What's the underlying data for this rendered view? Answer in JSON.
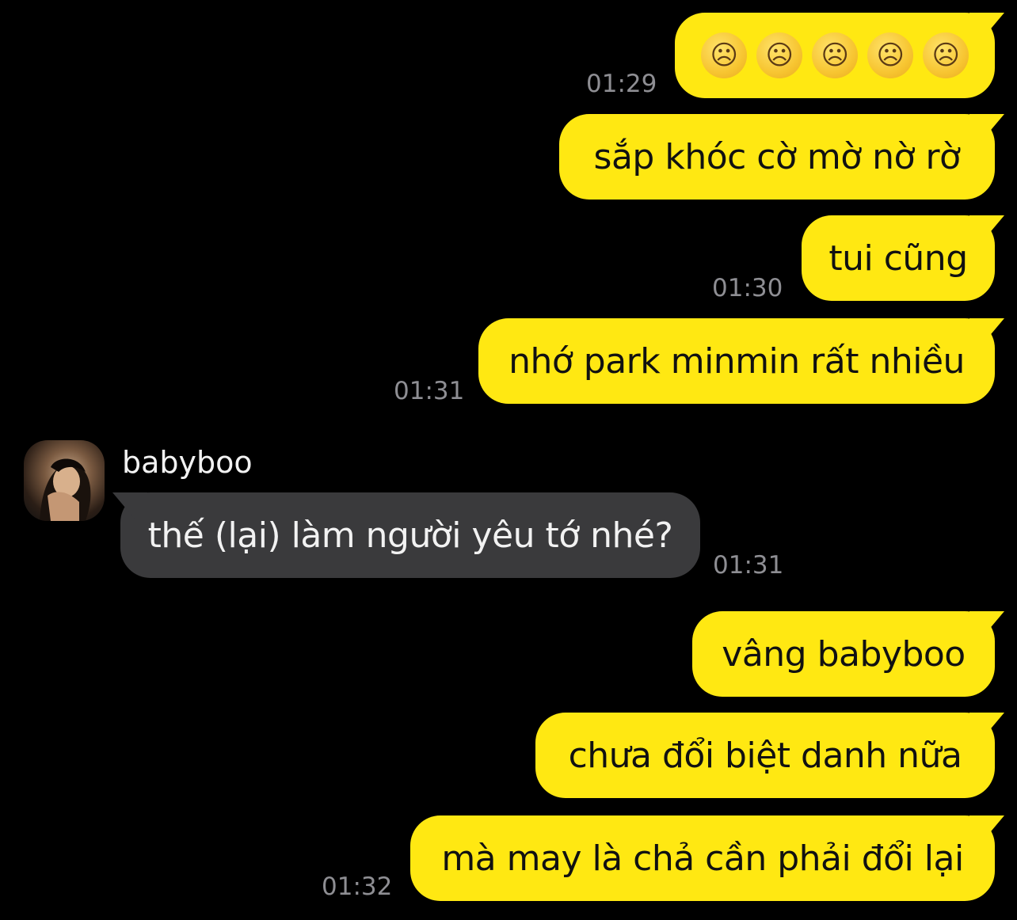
{
  "colors": {
    "background": "#000000",
    "outgoing_bubble": "#FFE812",
    "incoming_bubble": "#3A3A3C",
    "timestamp": "#8E8E93"
  },
  "messages": [
    {
      "from": "me",
      "type": "emoji",
      "emojis": [
        "☹",
        "☹",
        "☹",
        "☹",
        "☹"
      ],
      "emoji_names": [
        "worried-face",
        "confused-face",
        "slightly-frowning-face",
        "frowning-face",
        "loudly-crying-face"
      ],
      "time": "01:29"
    },
    {
      "from": "me",
      "text": "sắp khóc cờ mờ nờ rờ"
    },
    {
      "from": "me",
      "text": "tui cũng",
      "time": "01:30"
    },
    {
      "from": "me",
      "text": "nhớ park minmin rất nhiều",
      "time": "01:31"
    },
    {
      "from": "babyboo",
      "sender_name": "babyboo",
      "text": "thế (lại) làm người yêu tớ nhé?",
      "time": "01:31"
    },
    {
      "from": "me",
      "text": "vâng babyboo"
    },
    {
      "from": "me",
      "text": "chưa đổi biệt danh nữa"
    },
    {
      "from": "me",
      "text": "mà may là chả cần phải đổi lại",
      "time": "01:32"
    }
  ]
}
